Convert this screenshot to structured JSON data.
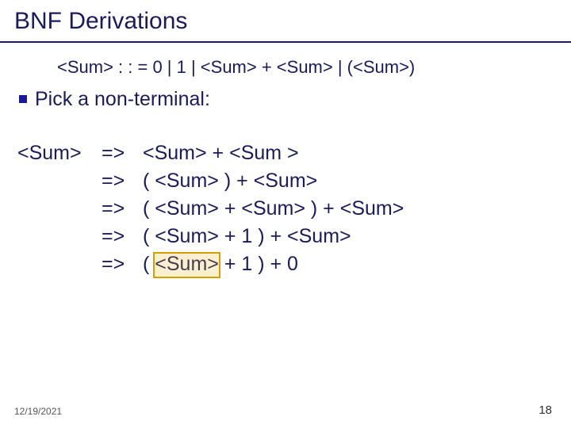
{
  "title": "BNF Derivations",
  "grammar_rule": "<Sum> : : = 0 | 1 | <Sum> + <Sum> | (<Sum>)",
  "pick_label": "Pick a non-terminal:",
  "derivation": {
    "lhs": "<Sum>",
    "arrow": "=>",
    "steps": [
      "<Sum> + <Sum >",
      "( <Sum> ) + <Sum>",
      "( <Sum> + <Sum> ) + <Sum>",
      "( <Sum> + 1 ) + <Sum>",
      {
        "prefix": "( ",
        "highlight": "<Sum>",
        "suffix": " + 1 ) + 0"
      }
    ]
  },
  "footer": {
    "date": "12/19/2021",
    "page": "18"
  }
}
